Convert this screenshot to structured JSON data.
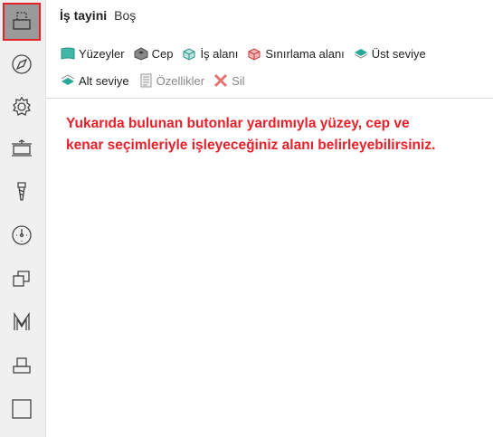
{
  "header": {
    "title": "İş tayini",
    "subtitle": "Boş"
  },
  "toolbar": {
    "row1": [
      {
        "label": "Yüzeyler",
        "icon": "surfaces-icon"
      },
      {
        "label": "Cep",
        "icon": "pocket-icon"
      },
      {
        "label": "İş alanı",
        "icon": "work-area-icon"
      },
      {
        "label": "Sınırlama alanı",
        "icon": "boundary-area-icon"
      },
      {
        "label": "Üst seviye",
        "icon": "top-level-icon"
      }
    ],
    "row2": [
      {
        "label": "Alt seviye",
        "icon": "bottom-level-icon"
      },
      {
        "label": "Özellikler",
        "icon": "properties-icon"
      },
      {
        "label": "Sil",
        "icon": "delete-icon"
      }
    ]
  },
  "message": "Yukarıda bulunan butonlar yardımıyla yüzey, cep ve kenar seçimleriyle işleyeceğiniz alanı belirleyebilirsiniz.",
  "colors": {
    "accent_red": "#e8202a",
    "sidebar_bg": "#f0f0f0",
    "active_bg": "#9a9a9a"
  }
}
